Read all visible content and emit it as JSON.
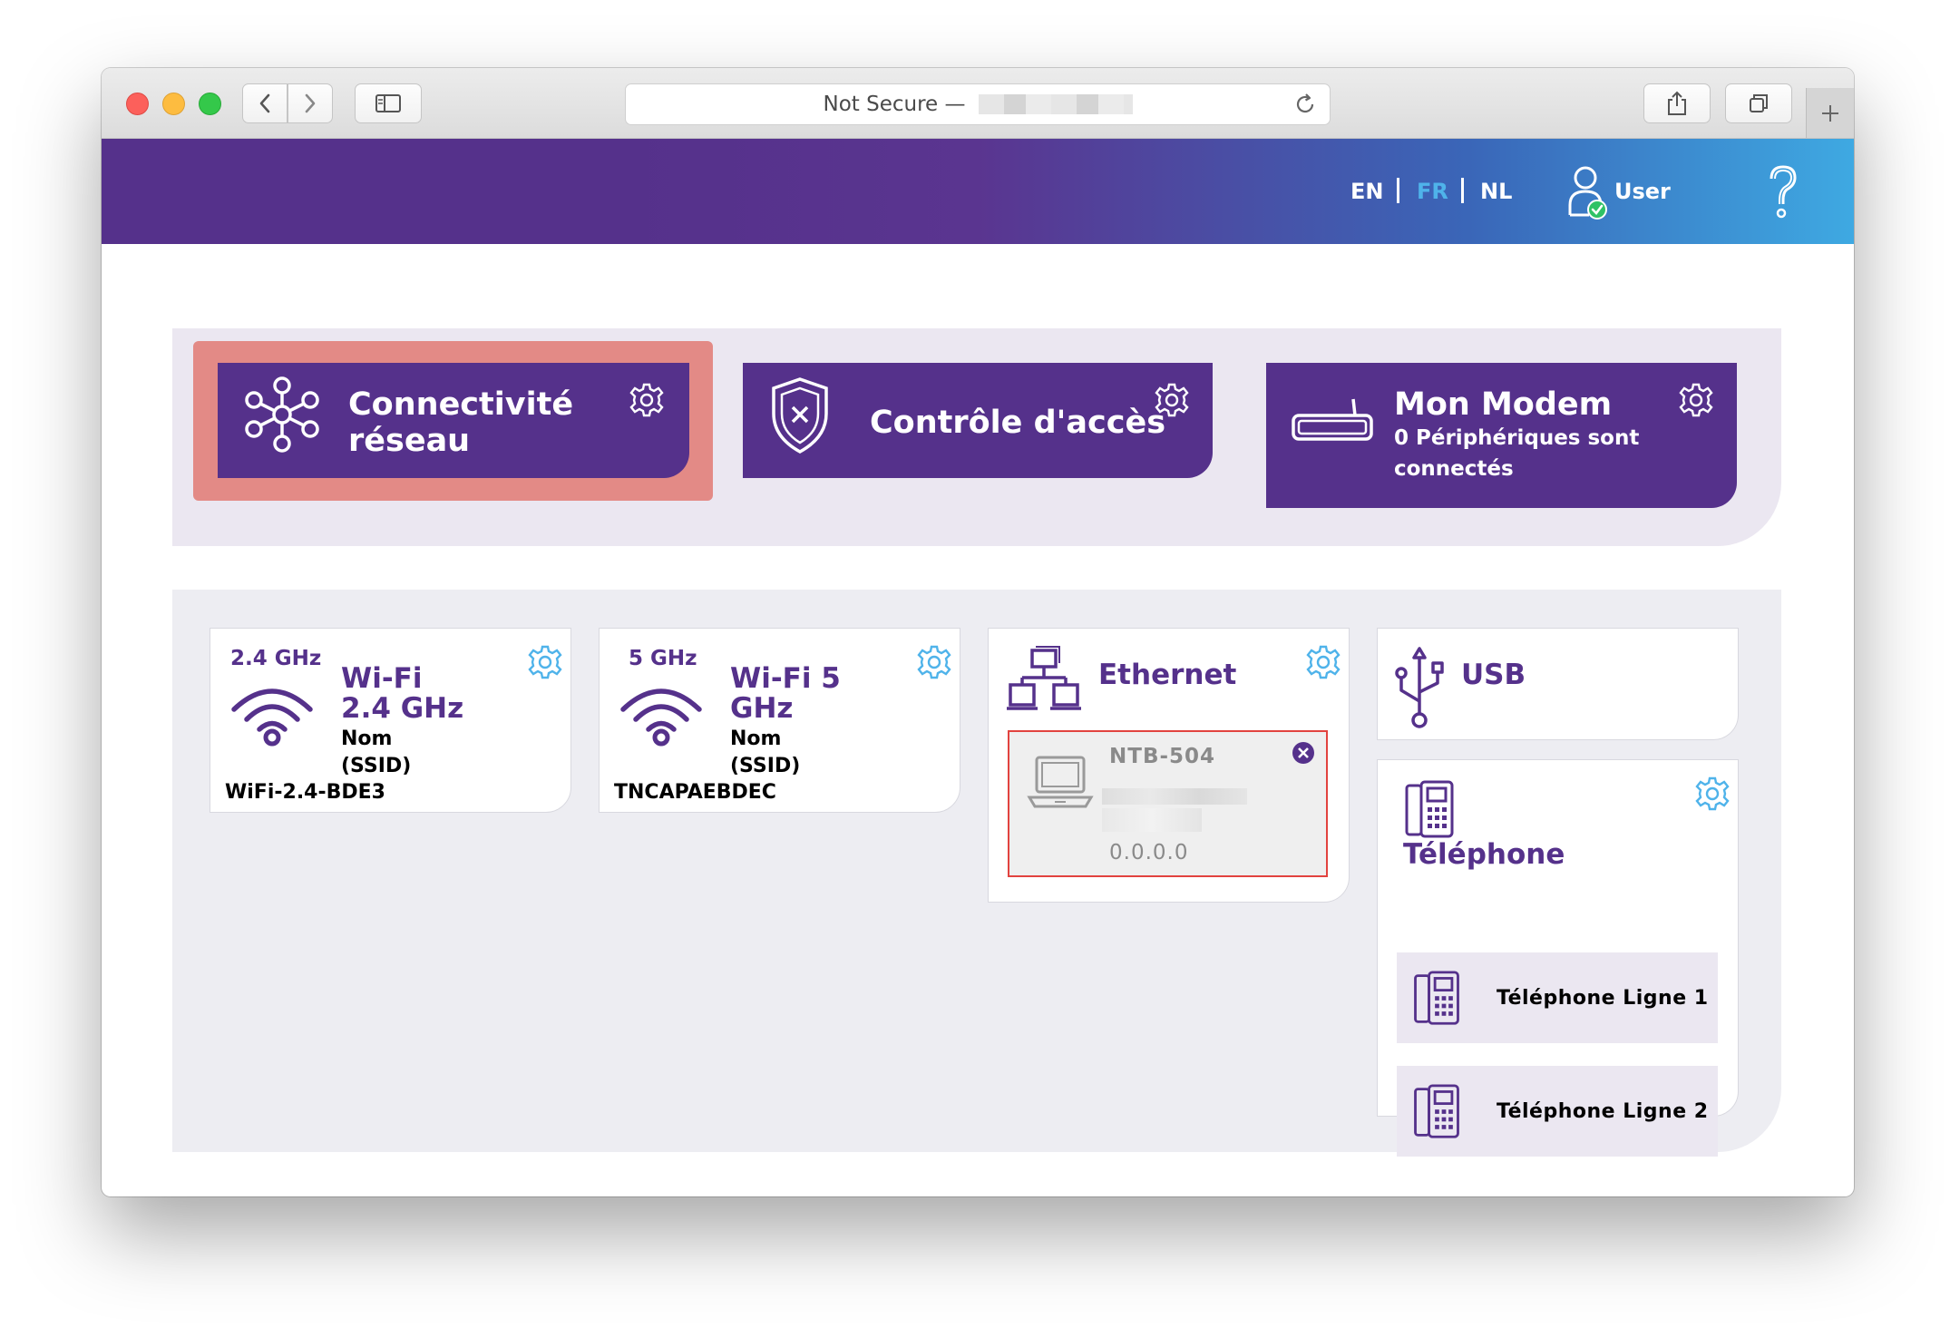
{
  "browser": {
    "address_prefix": "Not Secure —"
  },
  "header": {
    "lang_en": "EN",
    "lang_fr": "FR",
    "lang_nl": "NL",
    "active_lang_color": "#4fb3ea",
    "user_label": "User"
  },
  "tiles": {
    "connectivity_line1": "Connectivité",
    "connectivity_line2": "réseau",
    "access_control": "Contrôle d'accès",
    "modem_title": "Mon Modem",
    "modem_sub_line1": "0 Périphériques sont",
    "modem_sub_line2": "connectés"
  },
  "wifi24": {
    "freq": "2.4 GHz",
    "title_line1": "Wi-Fi",
    "title_line2": "2.4 GHz",
    "ssid_label_line1": "Nom",
    "ssid_label_line2": "(SSID)",
    "ssid_value": "WiFi-2.4-BDE3"
  },
  "wifi5": {
    "freq": "5 GHz",
    "title_line1": "Wi-Fi 5",
    "title_line2": "GHz",
    "ssid_label_line1": "Nom",
    "ssid_label_line2": "(SSID)",
    "ssid_value": "TNCAPAEBDEC"
  },
  "ethernet": {
    "title": "Ethernet",
    "device_name": "NTB-504",
    "device_ip": "0.0.0.0"
  },
  "usb": {
    "title": "USB"
  },
  "telephone": {
    "title": "Téléphone",
    "line1": "Téléphone Ligne 1",
    "line2": "Téléphone Ligne 2"
  },
  "colors": {
    "brand_purple": "#55318b",
    "accent_blue": "#4fb3ea",
    "highlight": "#e38a86",
    "error_red": "#e2433f"
  }
}
